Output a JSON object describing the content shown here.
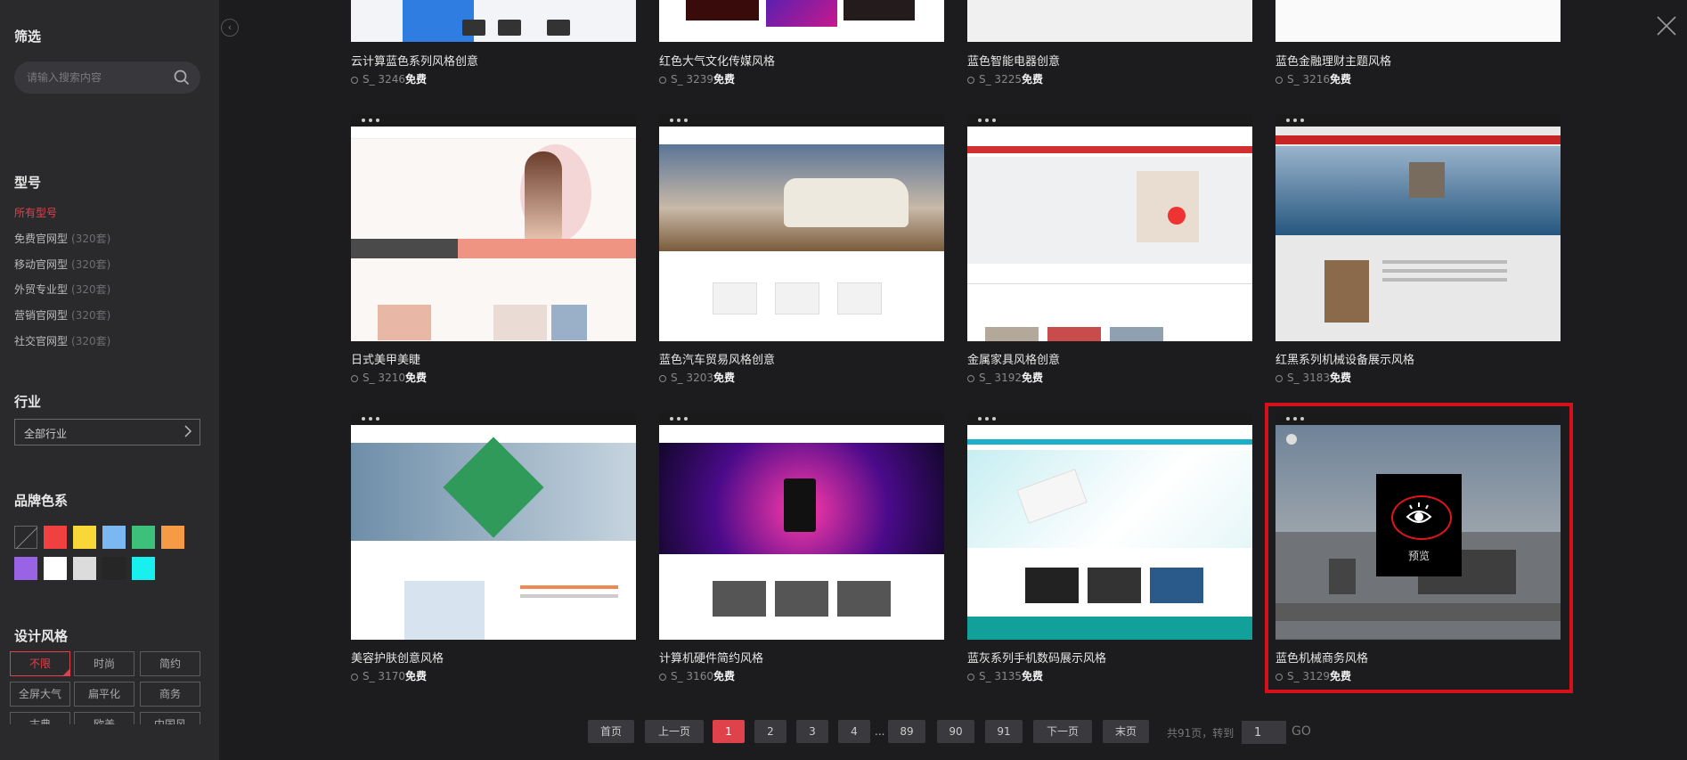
{
  "sidebar": {
    "filter_title": "筛选",
    "search_placeholder": "请输入搜索内容",
    "type_title": "型号",
    "types": [
      {
        "label": "所有型号",
        "count": ""
      },
      {
        "label": "免费官网型",
        "count": "(320套)"
      },
      {
        "label": "移动官网型",
        "count": "(320套)"
      },
      {
        "label": "外贸专业型",
        "count": "(320套)"
      },
      {
        "label": "营销官网型",
        "count": "(320套)"
      },
      {
        "label": "社交官网型",
        "count": "(320套)"
      }
    ],
    "industry_title": "行业",
    "industry_value": "全部行业",
    "color_title": "品牌色系",
    "colors": [
      "none",
      "#f04040",
      "#f8d838",
      "#7bb8f2",
      "#3cc07a",
      "#f59a45",
      "#9a63e6",
      "#ffffff",
      "#dcdcdc",
      "#262626",
      "#18f0f0"
    ],
    "style_title": "设计风格",
    "styles": [
      "不限",
      "时尚",
      "简约",
      "全屏大气",
      "扁平化",
      "商务",
      "古典",
      "欧美",
      "中国风"
    ]
  },
  "cards": [
    {
      "title": "云计算蓝色系列风格创意",
      "code": "S_ 3246",
      "price": "免费"
    },
    {
      "title": "红色大气文化传媒风格",
      "code": "S_ 3239",
      "price": "免费"
    },
    {
      "title": "蓝色智能电器创意",
      "code": "S_ 3225",
      "price": "免费"
    },
    {
      "title": "蓝色金融理财主题风格",
      "code": "S_ 3216",
      "price": "免费"
    },
    {
      "title": "日式美甲美睫",
      "code": "S_ 3210",
      "price": "免费"
    },
    {
      "title": "蓝色汽车贸易风格创意",
      "code": "S_ 3203",
      "price": "免费"
    },
    {
      "title": "金属家具风格创意",
      "code": "S_ 3192",
      "price": "免费"
    },
    {
      "title": "红黑系列机械设备展示风格",
      "code": "S_ 3183",
      "price": "免费"
    },
    {
      "title": "美容护肤创意风格",
      "code": "S_ 3170",
      "price": "免费"
    },
    {
      "title": "计算机硬件简约风格",
      "code": "S_ 3160",
      "price": "免费"
    },
    {
      "title": "蓝灰系列手机数码展示风格",
      "code": "S_ 3135",
      "price": "免费"
    },
    {
      "title": "蓝色机械商务风格",
      "code": "S_ 3129",
      "price": "免费"
    }
  ],
  "preview_label": "预览",
  "pagination": {
    "first": "首页",
    "prev": "上一页",
    "pages": [
      "1",
      "2",
      "3",
      "4"
    ],
    "ellipsis": "...",
    "tail_pages": [
      "89",
      "90",
      "91"
    ],
    "next": "下一页",
    "last": "末页",
    "summary": "共91页，转到",
    "goto_value": "1",
    "go": "GO"
  }
}
